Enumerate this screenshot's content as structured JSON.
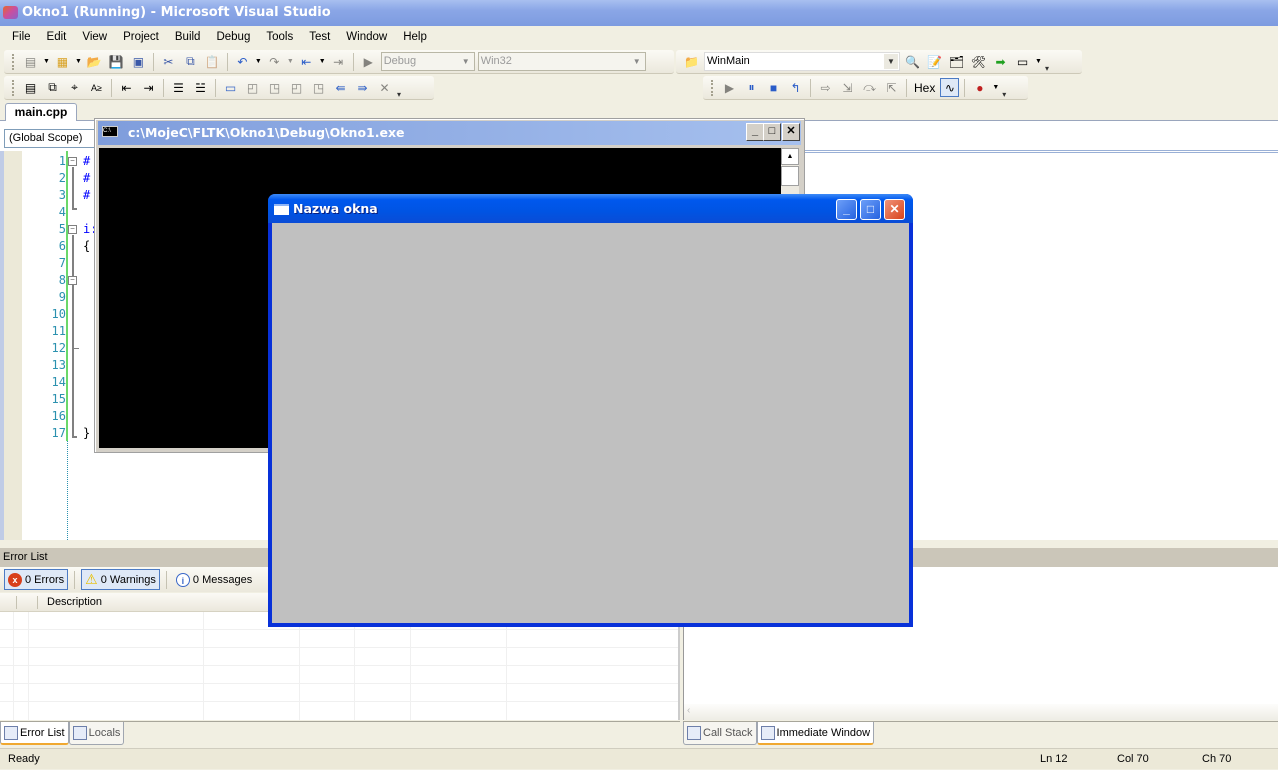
{
  "window": {
    "title": "Okno1 (Running) - Microsoft Visual Studio"
  },
  "menu": [
    "File",
    "Edit",
    "View",
    "Project",
    "Build",
    "Debug",
    "Tools",
    "Test",
    "Window",
    "Help"
  ],
  "toolbar": {
    "config": "Debug",
    "platform": "Win32",
    "find_combo": "WinMain",
    "hex_label": "Hex"
  },
  "editor": {
    "tab": "main.cpp",
    "scope": "(Global Scope)",
    "line_numbers": [
      "1",
      "2",
      "3",
      "4",
      "5",
      "6",
      "7",
      "8",
      "9",
      "10",
      "11",
      "12",
      "13",
      "14",
      "15",
      "16",
      "17"
    ],
    "code": [
      "#",
      "#",
      "#",
      "",
      "i:",
      "{",
      "",
      "",
      "",
      "",
      "",
      "",
      "",
      "",
      "",
      "",
      "}"
    ]
  },
  "console": {
    "title": "c:\\MojeC\\FLTK\\Okno1\\Debug\\Okno1.exe",
    "icon_text": "C:\\"
  },
  "fltk_window": {
    "title": "Nazwa okna"
  },
  "error_list": {
    "title": "Error List",
    "errors": "0 Errors",
    "warnings": "0 Warnings",
    "messages": "0 Messages",
    "col_description": "Description"
  },
  "bottom_tabs_left": [
    "Error List",
    "Locals"
  ],
  "bottom_tabs_right": [
    "Call Stack",
    "Immediate Window"
  ],
  "status": {
    "text": "Ready",
    "ln": "Ln 12",
    "col": "Col 70",
    "ch": "Ch 70"
  }
}
